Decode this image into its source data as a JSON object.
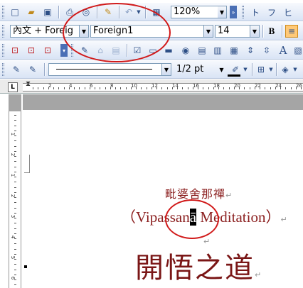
{
  "toolbar_standard": {
    "zoom_value": "120%",
    "extra_glyphs": [
      "ト",
      "フ",
      "ヒ"
    ]
  },
  "toolbar_format": {
    "style_value": "內文 + Foreig",
    "font_value": "Foreign1",
    "size_value": "14",
    "bold_label": "B"
  },
  "toolbar_drawing": {
    "text_label": "A"
  },
  "toolbar_lines": {
    "line_weight": "1/2 pt"
  },
  "ruler": {
    "tab_label": "L",
    "numbers": [
      "2",
      "4",
      "6",
      "8",
      "10",
      "12",
      "14",
      "16",
      "18",
      "20",
      "22",
      "24",
      "26"
    ]
  },
  "vruler": {
    "numbers": [
      "1",
      "2",
      "1",
      "2",
      "3",
      "4",
      "5",
      "6",
      "7",
      "8"
    ]
  },
  "document": {
    "line1": "毗婆舍那禪",
    "line2_before": "（Vipassan",
    "line2_selected": "ā",
    "line2_after": " Meditation）",
    "line3": "開悟之道",
    "para_mark": "↵"
  },
  "colors": {
    "text_red": "#8b1f1f",
    "annotation": "#d11a1a",
    "toolbar_bg": "#d9e4f5"
  }
}
